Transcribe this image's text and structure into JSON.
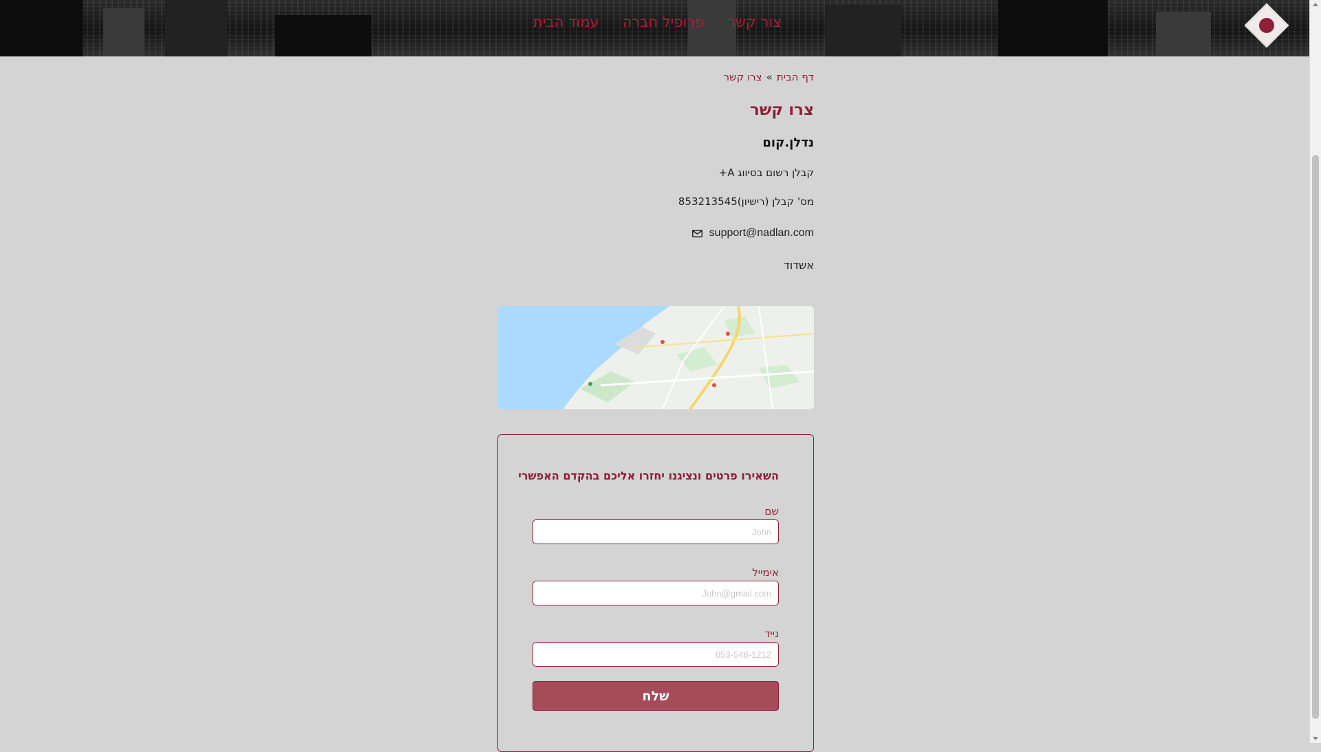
{
  "nav": {
    "items": [
      {
        "label": "עמוד הבית"
      },
      {
        "label": "פרופיל חברה"
      },
      {
        "label": "צור קשר"
      }
    ]
  },
  "breadcrumb": {
    "home": "דף הבית",
    "separator": "»",
    "current": "צרו קשר"
  },
  "page": {
    "title": "צרו קשר",
    "company_name": "נדלן.קום",
    "contractor_line": "קבלן רשום בסיווג A+",
    "license_line": "מס' קבלן (רישיון)853213545",
    "email": "support@nadlan.com",
    "city": "אשדוד"
  },
  "map": {
    "icon": "map-image"
  },
  "form": {
    "heading": "השאירו פרטים ונציגנו יחזרו אליכם בהקדם האפשרי",
    "name_label": "שם",
    "name_placeholder": "John",
    "email_label": "אימייל",
    "email_placeholder": "John@gmail.com",
    "phone_label": "נייד",
    "phone_placeholder": "053-548-1212",
    "submit_label": "שלח"
  },
  "colors": {
    "brand": "#8e1f35",
    "button": "#a64b5a",
    "background": "#d4d4d4"
  }
}
